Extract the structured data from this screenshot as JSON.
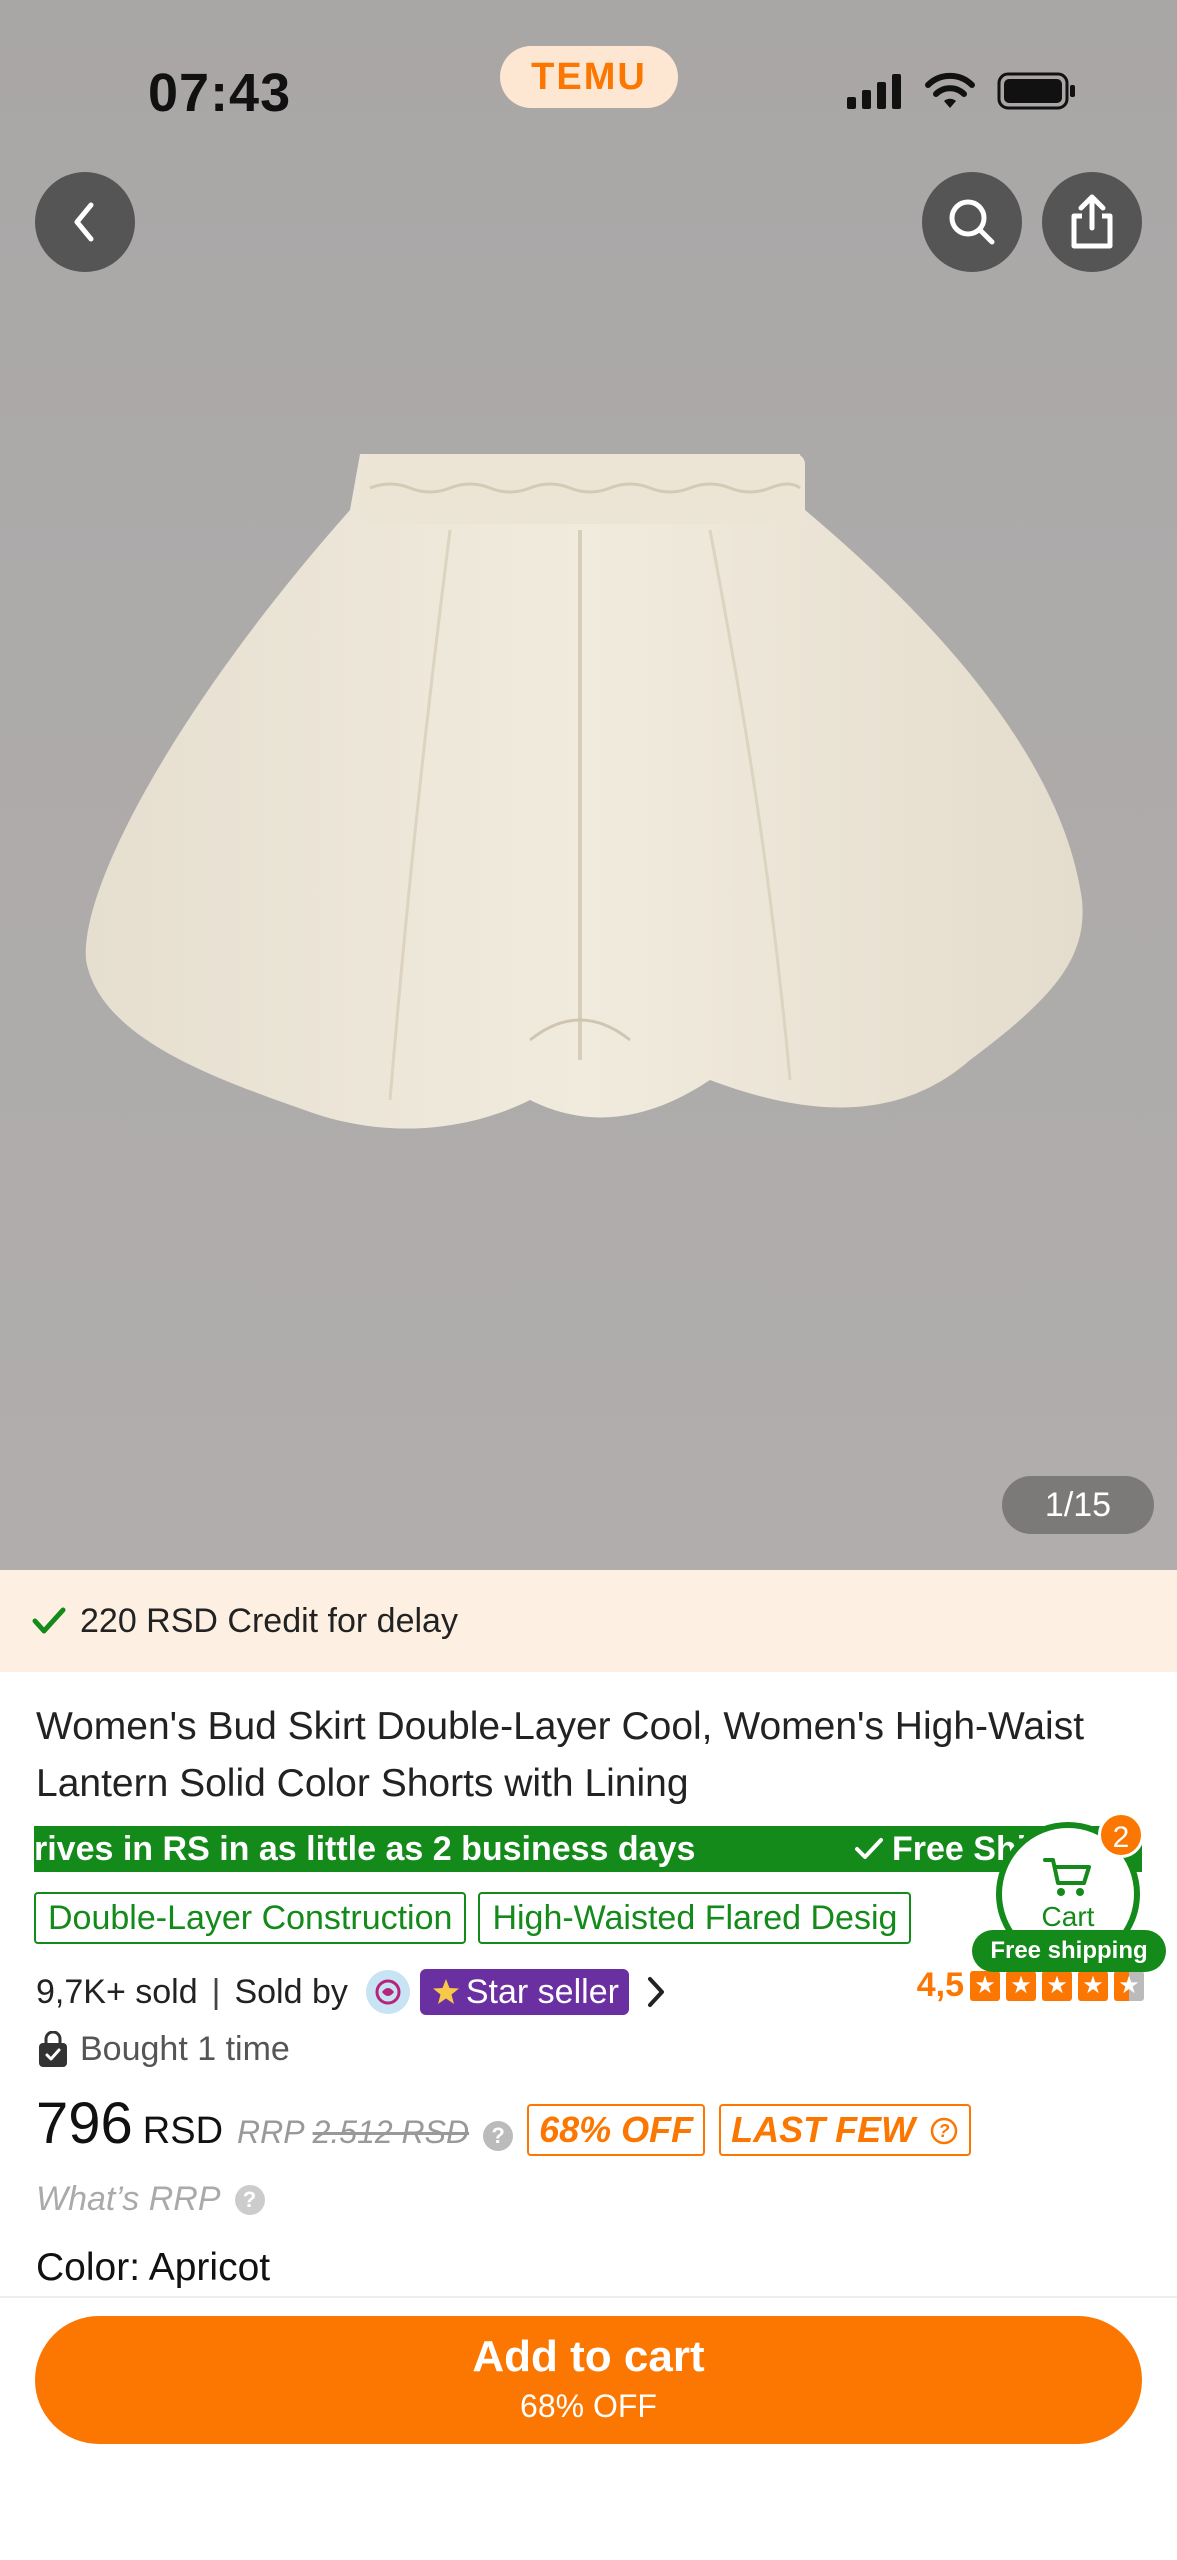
{
  "status_bar": {
    "time": "07:43",
    "brand": "TEMU"
  },
  "gallery": {
    "counter": "1/15"
  },
  "banner": {
    "credit_text": "220 RSD Credit for delay"
  },
  "product": {
    "title": "Women's Bud Skirt Double-Layer Cool, Women's High-Waist Lantern Solid Color Shorts with Lining",
    "shipping_left": "rives in RS in as little as 2 business days",
    "shipping_right": "Free Shi",
    "tags": [
      "Double-Layer Construction",
      "High-Waisted Flared Desig"
    ],
    "sold": "9,7K+ sold",
    "sold_by": "Sold by",
    "seller_badge": "Star seller",
    "rating": "4,5",
    "bought": "Bought 1 time",
    "price": "796",
    "currency": "RSD",
    "rrp_label": "RRP",
    "rrp_value": "2.512 RSD",
    "discount_badge": "68% OFF",
    "last_few": "LAST FEW",
    "whats_rrp": "What’s RRP",
    "color_label": "Color: Apricot"
  },
  "cart": {
    "label": "Cart",
    "count": "2",
    "free_shipping": "Free shipping"
  },
  "bottom": {
    "add_to_cart": "Add to cart",
    "add_sub": "68% OFF"
  },
  "colors": {
    "accent": "#fb7701",
    "green": "#138a1a",
    "seller_purple": "#6a2fa1"
  }
}
